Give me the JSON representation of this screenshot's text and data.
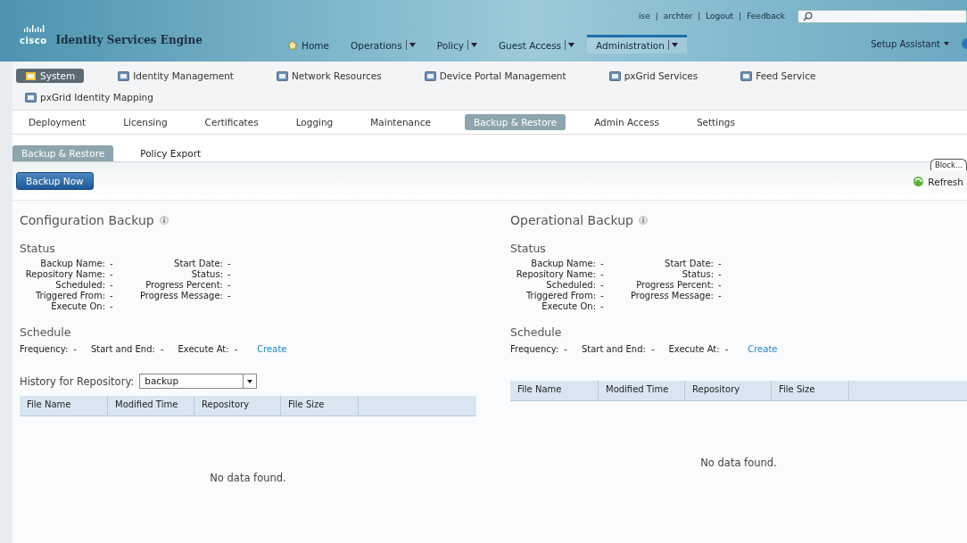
{
  "header": {
    "product_name": "Identity Services Engine",
    "logo_text": "cisco",
    "user_links": [
      {
        "kind": "link",
        "label": "ise"
      },
      {
        "kind": "separator",
        "label": "|"
      },
      {
        "kind": "link",
        "label": "archter"
      },
      {
        "kind": "separator",
        "label": "|"
      },
      {
        "kind": "link",
        "label": "Logout"
      },
      {
        "kind": "separator",
        "label": "|"
      },
      {
        "kind": "link",
        "label": "Feedback"
      }
    ],
    "main_nav": [
      {
        "label": "Home",
        "selected": false,
        "dropdown": false,
        "home": true
      },
      {
        "label": "Operations",
        "selected": false,
        "dropdown": true,
        "home": false
      },
      {
        "label": "Policy",
        "selected": false,
        "dropdown": true,
        "home": false
      },
      {
        "label": "Guest Access",
        "selected": false,
        "dropdown": true,
        "home": false
      },
      {
        "label": "Administration",
        "selected": true,
        "dropdown": true,
        "home": false
      }
    ],
    "setup_assistant": "Setup Assistant"
  },
  "admin_menu": [
    {
      "label": "System",
      "selected": true
    },
    {
      "label": "Identity Management",
      "selected": false
    },
    {
      "label": "Network Resources",
      "selected": false
    },
    {
      "label": "Device Portal Management",
      "selected": false
    },
    {
      "label": "pxGrid Services",
      "selected": false
    },
    {
      "label": "Feed Service",
      "selected": false
    },
    {
      "label": "pxGrid Identity Mapping",
      "selected": false
    }
  ],
  "sub_tabs": [
    {
      "label": "Deployment",
      "selected": false
    },
    {
      "label": "Licensing",
      "selected": false
    },
    {
      "label": "Certificates",
      "selected": false
    },
    {
      "label": "Logging",
      "selected": false
    },
    {
      "label": "Maintenance",
      "selected": false
    },
    {
      "label": "Backup & Restore",
      "selected": true
    },
    {
      "label": "Admin Access",
      "selected": false
    },
    {
      "label": "Settings",
      "selected": false
    }
  ],
  "page_tabs": [
    {
      "label": "Backup & Restore",
      "selected": true
    },
    {
      "label": "Policy Export",
      "selected": false
    }
  ],
  "toolbar": {
    "backup_button": "Backup Now",
    "block_tab": "Block...",
    "refresh": "Refresh"
  },
  "panels": [
    {
      "title": "Configuration Backup",
      "status_heading": "Status",
      "status_rows": [
        {
          "left": {
            "label": "Backup Name:",
            "value": "-"
          },
          "right": {
            "label": "Start Date:",
            "value": "-"
          }
        },
        {
          "left": {
            "label": "Repository Name:",
            "value": "-"
          },
          "right": {
            "label": "Status:",
            "value": "-"
          }
        },
        {
          "left": {
            "label": "Scheduled:",
            "value": "-"
          },
          "right": {
            "label": "Progress Percent:",
            "value": "-"
          }
        },
        {
          "left": {
            "label": "Triggered From:",
            "value": "-"
          },
          "right": {
            "label": "Progress Message:",
            "value": "-"
          }
        },
        {
          "left": {
            "label": "Execute On:",
            "value": "-"
          }
        }
      ],
      "schedule_heading": "Schedule",
      "schedule": [
        {
          "label": "Frequency:",
          "value": "-"
        },
        {
          "label": "Start and End:",
          "value": "-"
        },
        {
          "label": "Execute At:",
          "value": "-"
        }
      ],
      "create_link": "Create",
      "history": {
        "label": "History for Repository:",
        "value": "backup"
      },
      "table": {
        "columns": [
          "File Name",
          "Modified Time",
          "Repository",
          "File Size"
        ],
        "empty_text": "No data found."
      }
    },
    {
      "title": "Operational Backup",
      "status_heading": "Status",
      "status_rows": [
        {
          "left": {
            "label": "Backup Name:",
            "value": "-"
          },
          "right": {
            "label": "Start Date:",
            "value": "-"
          }
        },
        {
          "left": {
            "label": "Repository Name:",
            "value": "-"
          },
          "right": {
            "label": "Status:",
            "value": "-"
          }
        },
        {
          "left": {
            "label": "Scheduled:",
            "value": "-"
          },
          "right": {
            "label": "Progress Percent:",
            "value": "-"
          }
        },
        {
          "left": {
            "label": "Triggered From:",
            "value": "-"
          },
          "right": {
            "label": "Progress Message:",
            "value": "-"
          }
        },
        {
          "left": {
            "label": "Execute On:",
            "value": "-"
          }
        }
      ],
      "schedule_heading": "Schedule",
      "schedule": [
        {
          "label": "Frequency:",
          "value": "-"
        },
        {
          "label": "Start and End:",
          "value": "-"
        },
        {
          "label": "Execute At:",
          "value": "-"
        }
      ],
      "create_link": "Create",
      "table": {
        "columns": [
          "File Name",
          "Modified Time",
          "Repository",
          "File Size"
        ],
        "empty_text": "No data found."
      }
    }
  ]
}
